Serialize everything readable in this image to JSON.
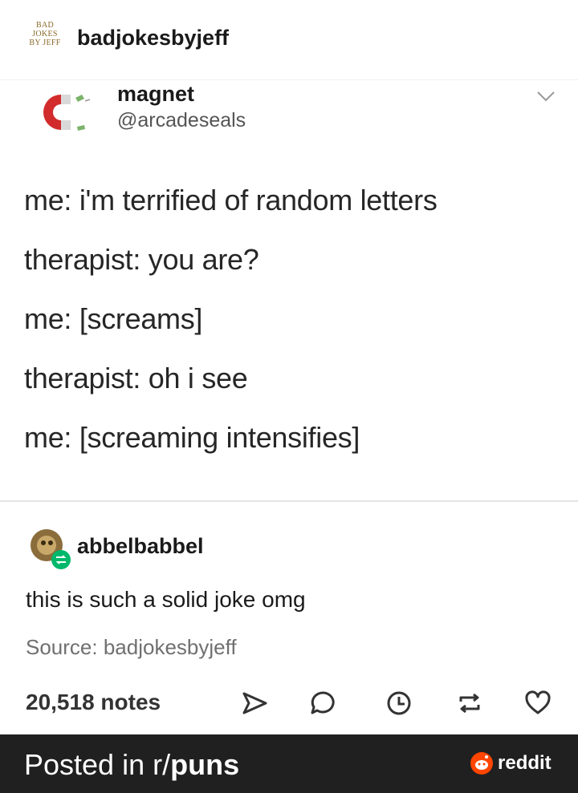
{
  "header": {
    "blog_logo_text": "BAD JOKES BY JEFF",
    "blog_name": "badjokesbyjeff"
  },
  "post": {
    "author_name": "magnet",
    "author_handle": "@arcadeseals",
    "lines": [
      "me: i'm terrified of random letters",
      "therapist: you are?",
      "me: [screams]",
      "therapist: oh i see",
      "me: [screaming intensifies]"
    ]
  },
  "reblog": {
    "username": "abbelbabbel",
    "comment": "this is such a solid joke omg",
    "source": "Source: badjokesbyjeff"
  },
  "actions": {
    "notes": "20,518 notes",
    "icons": [
      "share-icon",
      "reply-icon",
      "history-icon",
      "reblog-icon",
      "like-icon"
    ]
  },
  "footer": {
    "prefix": "Posted in r/",
    "subreddit": "puns",
    "brand": "reddit"
  },
  "colors": {
    "footer_bg": "#202020",
    "reddit_orange": "#ff4500",
    "reblog_green": "#00b86b",
    "magnet_red": "#d22b2b"
  }
}
